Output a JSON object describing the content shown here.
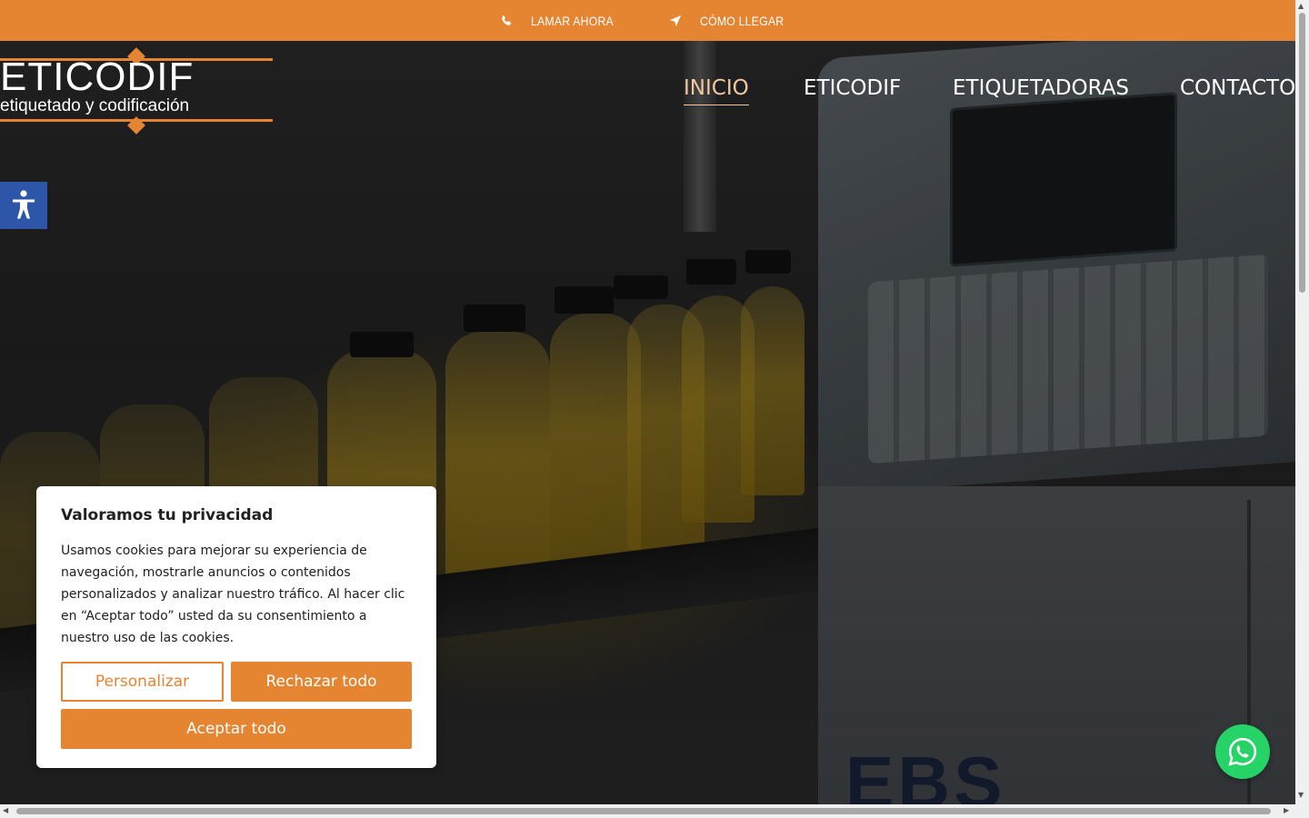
{
  "topbar": {
    "call_label": "LAMAR AHORA",
    "call_icon": "phone-icon",
    "directions_label": "CÓMO LLEGAR",
    "directions_icon": "location-arrow-icon",
    "background": "#e58431"
  },
  "logo": {
    "title": "ETICODIF",
    "subtitle": "etiquetado y codificación"
  },
  "nav": {
    "items": [
      {
        "label": "INICIO",
        "active": true
      },
      {
        "label": "ETICODIF",
        "active": false
      },
      {
        "label": "ETIQUETADORAS",
        "active": false
      },
      {
        "label": "CONTACTO",
        "active": false
      }
    ]
  },
  "accessibility": {
    "icon": "accessibility-icon",
    "color": "#2d55a8"
  },
  "cookie": {
    "title": "Valoramos tu privacidad",
    "body": "Usamos cookies para mejorar su experiencia de navegación, mostrarle anuncios o contenidos personalizados y analizar nuestro tráfico. Al hacer clic en “Aceptar todo” usted da su consentimiento a nuestro uso de las cookies.",
    "customize_label": "Personalizar",
    "reject_label": "Rechazar todo",
    "accept_label": "Aceptar todo",
    "accent": "#e58431"
  },
  "whatsapp": {
    "icon": "whatsapp-icon",
    "color": "#25d366"
  }
}
